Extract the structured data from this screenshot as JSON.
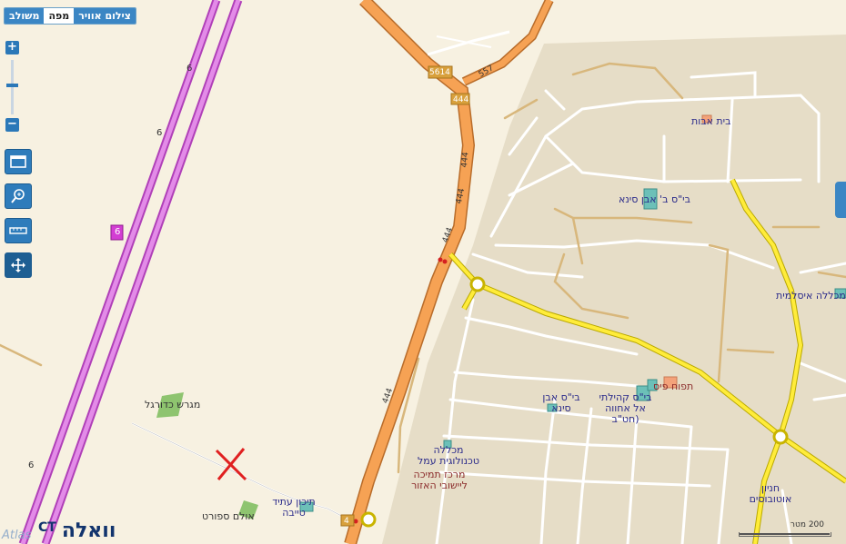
{
  "map_type_tabs": [
    {
      "label": "משולב",
      "active": false
    },
    {
      "label": "מפה",
      "active": true
    },
    {
      "label": "צילום אוויר",
      "active": false
    }
  ],
  "zoom": {
    "in_label": "+",
    "out_label": "−"
  },
  "tools": [
    {
      "name": "full-screen-icon"
    },
    {
      "name": "zoom-search-icon"
    },
    {
      "name": "ruler-icon"
    },
    {
      "name": "pan-icon"
    }
  ],
  "road_shields": {
    "r6_a": "6",
    "r6_b": "6",
    "r6_c": "6",
    "r6_d": "6",
    "r444_a": "444",
    "r444_b": "444",
    "r444_c": "444",
    "r444_d": "444",
    "r444_e": "444",
    "r557": "557",
    "r5614": "5614",
    "r4": "4"
  },
  "places": {
    "beit_avot": "בית אבות",
    "school_ibn_sina_1": "בי\"ס ב' אבן סינא",
    "mihlala": "מכללה איסלמית",
    "tfuha": "תפוח פיס",
    "school_kehilati": "בי\"ס קהילתי אל אחווה (חט\"ב",
    "school_ibn_sina_2": "בי\"ס אבן סינא",
    "mihlala_amal": "מכללה טכנולוגית עמל",
    "merkaz": "מרכז תמיכה ליישובי האזור",
    "migrash": "מגרש כדורגל",
    "tichon": "תיכון עתיד טייבה",
    "ulam": "אולם ספורט",
    "hanion": "חניון אוטובוסים"
  },
  "scale_label": "200 מטר",
  "logo": {
    "ct": "CT",
    "walla": "וואלה",
    "atlas": "Atlas"
  }
}
